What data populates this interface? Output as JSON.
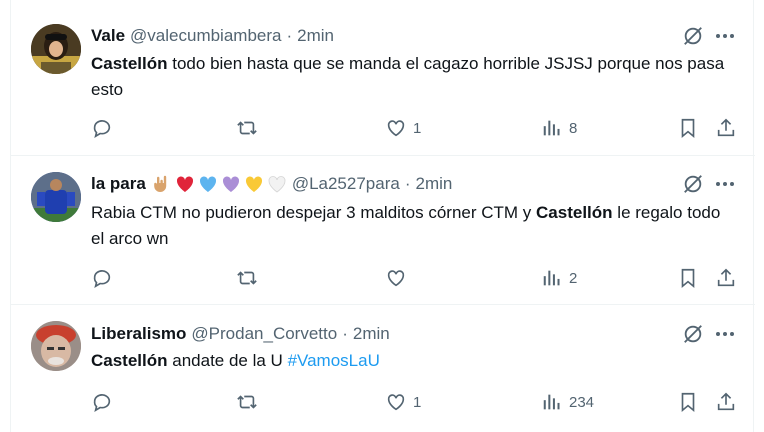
{
  "tweets": [
    {
      "name": "Vale",
      "handle": "@valecumbiambera",
      "sep": "·",
      "time": "2min",
      "text_bold": "Castellón",
      "text_rest": " todo bien hasta que se manda el cagazo horrible JSJSJ porque nos pasa esto",
      "reply_count": "",
      "retweet_count": "",
      "like_count": "1",
      "view_count": "8"
    },
    {
      "name": "la para",
      "handle": "@La2527para",
      "sep": "·",
      "time": "2min",
      "emojis": [
        "rock-hand",
        "red-heart",
        "light-blue-heart",
        "purple-heart",
        "yellow-heart",
        "white-heart"
      ],
      "text_pre": "Rabia CTM no pudieron despejar 3 malditos córner CTM y ",
      "text_bold": "Castellón",
      "text_post": " le regalo todo el arco wn",
      "reply_count": "",
      "retweet_count": "",
      "like_count": "",
      "view_count": "2"
    },
    {
      "name": "Liberalismo",
      "handle": "@Prodan_Corvetto",
      "sep": "·",
      "time": "2min",
      "text_bold": "Castellón",
      "text_rest": " andate de la U ",
      "hashtag": "#VamosLaU",
      "reply_count": "",
      "retweet_count": "",
      "like_count": "1",
      "view_count": "234"
    }
  ],
  "colors": {
    "text": "#0f1419",
    "muted": "#536471",
    "link": "#1d9bf0",
    "border": "#eff3f4"
  }
}
